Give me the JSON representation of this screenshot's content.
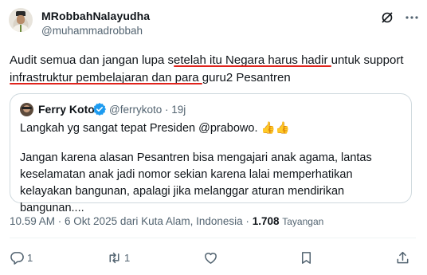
{
  "author": {
    "display_name": "MRobbahNalayudha",
    "handle": "@muhammadrobbah"
  },
  "tweet": {
    "text": "Audit semua dan jangan lupa setelah itu Negara harus hadir untuk support infrastruktur pembelajaran dan para guru2 Pesantren"
  },
  "quoted_tweet": {
    "display_name": "Ferry Koto",
    "handle_time": "@ferrykoto · 19j",
    "line1": "Langkah yg sangat tepat Presiden @prabowo. 👍👍",
    "line2": "Jangan karena alasan Pesantren bisa mengajari anak agama, lantas keselamatan anak jadi nomor sekian karena lalai memperhatikan kelayakan bangunan, apalagi jika melanggar aturan mendirikan bangunan...."
  },
  "meta": {
    "time": "10.59 AM · 6 Okt 2025 dari Kuta Alam, Indonesia · ",
    "views_count": "1.708",
    "views_label": "Tayangan"
  },
  "actions": {
    "reply_count": "1",
    "repost_count": "1"
  },
  "colors": {
    "accent_underline": "#e0231c",
    "verified": "#1d9bf0",
    "secondary_text": "#536471"
  },
  "icons": [
    "grok-icon",
    "more-icon",
    "verified-icon",
    "reply-icon",
    "repost-icon",
    "like-icon",
    "bookmark-icon",
    "share-icon"
  ]
}
